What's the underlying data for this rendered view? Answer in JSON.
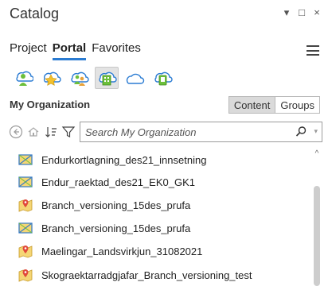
{
  "window": {
    "title": "Catalog",
    "controls": {
      "dropdown": "▾",
      "restore": "□",
      "close": "×"
    }
  },
  "tabs": [
    {
      "label": "Project",
      "active": false
    },
    {
      "label": "Portal",
      "active": true
    },
    {
      "label": "Favorites",
      "active": false
    }
  ],
  "source_icons": [
    "my-content-icon",
    "favorites-star-icon",
    "groups-icon",
    "my-organization-icon",
    "arcgis-online-icon",
    "living-atlas-icon"
  ],
  "organization": {
    "heading": "My Organization",
    "toggle": {
      "content_label": "Content",
      "groups_label": "Groups",
      "selected": "Content"
    }
  },
  "search": {
    "placeholder": "Search My Organization",
    "value": ""
  },
  "items": [
    {
      "label": "Endurkortlagning_des21_innsetning",
      "icon": "feature-layer-icon"
    },
    {
      "label": "Endur_raektad_des21_EK0_GK1",
      "icon": "feature-layer-icon"
    },
    {
      "label": "Branch_versioning_15des_prufa",
      "icon": "map-service-icon"
    },
    {
      "label": "Branch_versioning_15des_prufa",
      "icon": "feature-layer-icon"
    },
    {
      "label": "Maelingar_Landsvirkjun_31082021",
      "icon": "map-service-icon"
    },
    {
      "label": "Skograektarradgjafar_Branch_versioning_test",
      "icon": "map-service-icon"
    }
  ],
  "colors": {
    "accent": "#2a7bd1",
    "icon_green": "#6cbf3b",
    "icon_blue": "#2b7cd3",
    "icon_orange": "#e8a23a"
  }
}
